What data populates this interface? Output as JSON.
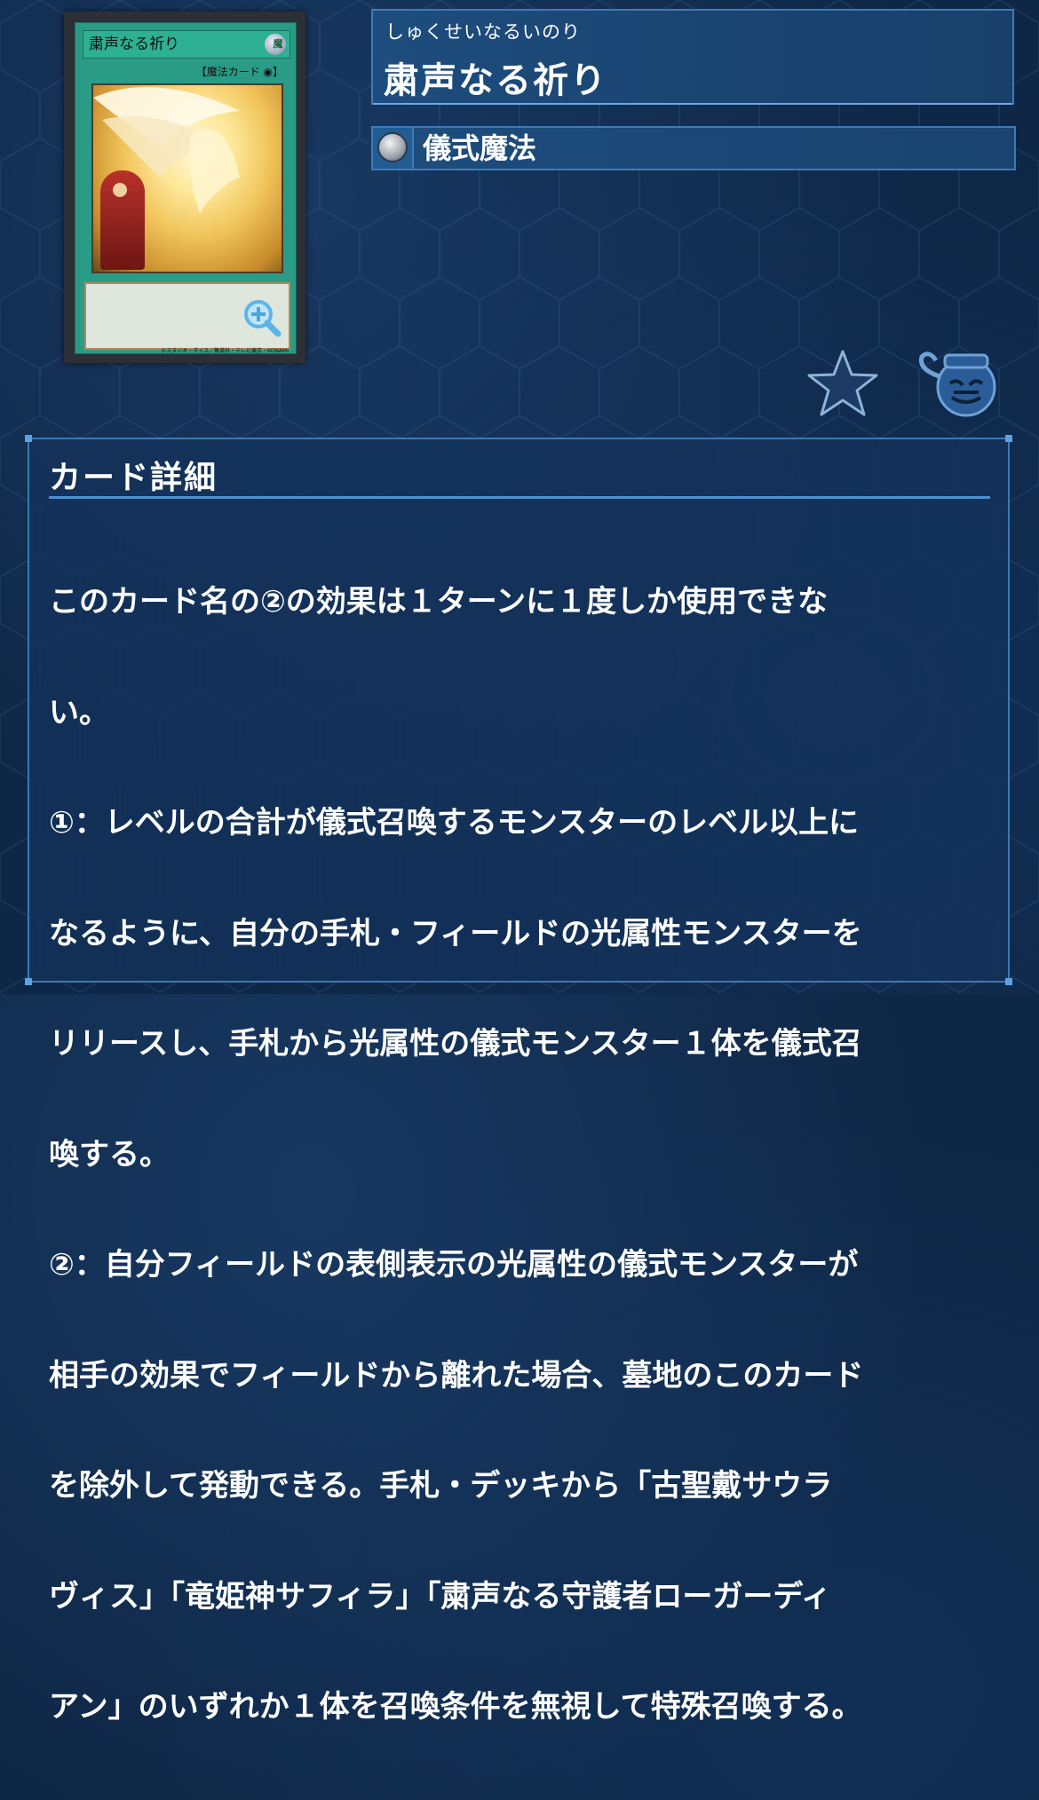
{
  "card": {
    "name_ruby": "しゅくせいなるいのり",
    "name": "粛声なる祈り",
    "type": "儀式魔法",
    "image": {
      "name_on_card": "粛声なる祈り",
      "attribute_glyph": "魔",
      "type_line": "【魔法カード",
      "copyright": "©スタジオ・ダイス／集英社・テレビ東京・KONAMI"
    }
  },
  "icons": {
    "type_icon": "ritual-spell-icon",
    "favorite": "star-icon",
    "deck": "pot-of-greed-icon",
    "zoom": "zoom-in-icon"
  },
  "detail": {
    "heading": "カード詳細",
    "text_lines": [
      "このカード名の②の効果は１ターンに１度しか使用できな",
      "い。",
      "①：レベルの合計が儀式召喚するモンスターのレベル以上に",
      "なるように、自分の手札・フィールドの光属性モンスターを",
      "リリースし、手札から光属性の儀式モンスター１体を儀式召",
      "喚する。",
      "②：自分フィールドの表側表示の光属性の儀式モンスターが",
      "相手の効果でフィールドから離れた場合、墓地のこのカード",
      "を除外して発動できる。手札・デッキから「古聖戴サウラ",
      "ヴィス」「竜姫神サフィラ」「粛声なる守護者ローガーディ",
      "アン」のいずれか１体を召喚条件を無視して特殊召喚する。"
    ]
  },
  "colors": {
    "background": "#0f2746",
    "panel": "#1a4370",
    "border": "#3f7ab7",
    "card_green": "#2a9b85"
  }
}
